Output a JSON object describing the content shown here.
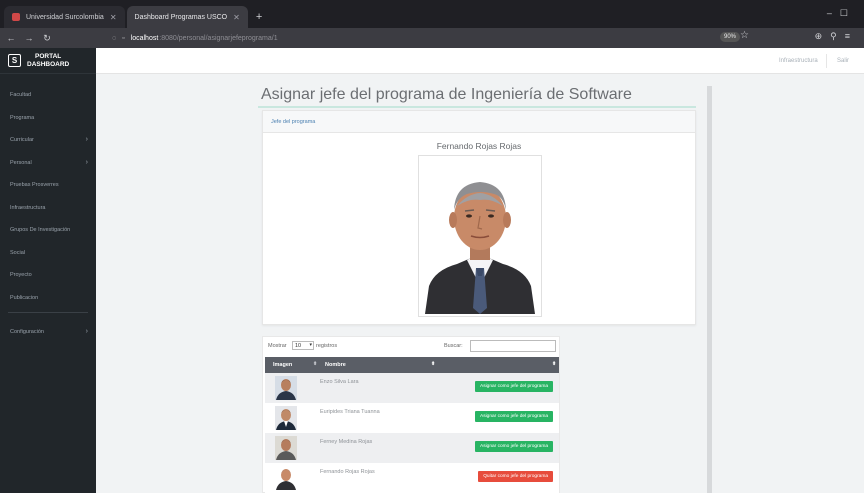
{
  "browser": {
    "tabs": [
      {
        "label": "Universidad Surcolombia",
        "active": false
      },
      {
        "label": "Dashboard Programas USCO",
        "active": true
      }
    ],
    "new_tab": "+",
    "url_host": "localhost",
    "url_path": ":8080/personal/asignarjefeprograma/1",
    "zoom": "90%"
  },
  "header": {
    "user_link": "Infraestructura",
    "exit_link": "Salir"
  },
  "sidebar": {
    "brand_line1": "PORTAL",
    "brand_line2": "DASHBOARD",
    "brand_logo": "S",
    "items": [
      {
        "label": "Facultad",
        "has_submenu": false
      },
      {
        "label": "Programa",
        "has_submenu": false
      },
      {
        "label": "Curricular",
        "has_submenu": true
      },
      {
        "label": "Personal",
        "has_submenu": true
      },
      {
        "label": "Pruebas Prosverres",
        "has_submenu": false
      },
      {
        "label": "Infraestructura",
        "has_submenu": false
      },
      {
        "label": "Grupos De Investigación",
        "has_submenu": false
      },
      {
        "label": "Social",
        "has_submenu": false
      },
      {
        "label": "Proyecto",
        "has_submenu": false
      },
      {
        "label": "Publicacion",
        "has_submenu": false
      }
    ],
    "config_item": {
      "label": "Configuración",
      "has_submenu": true
    }
  },
  "main": {
    "title": "Asignar jefe del programa de Ingeniería de Software",
    "card_header": "Jefe del programa",
    "current_head_name": "Fernando Rojas Rojas"
  },
  "table": {
    "show_label": "Mostrar",
    "show_value": "10",
    "records_label": "registros",
    "search_label": "Buscar:",
    "search_value": "",
    "columns": [
      "Imagen",
      "Nombre",
      ""
    ],
    "rows": [
      {
        "name": "Enzo Silva Lara",
        "action": "Asignar como jefe del programa",
        "action_type": "assign"
      },
      {
        "name": "Euripides Triana Tuanna",
        "action": "Asignar como jefe del programa",
        "action_type": "assign"
      },
      {
        "name": "Ferney Medina Rojas",
        "action": "Asignar como jefe del programa",
        "action_type": "assign"
      },
      {
        "name": "Fernando Rojas Rojas",
        "action": "Quitar como jefe del programa",
        "action_type": "remove"
      }
    ]
  },
  "colors": {
    "sidebar_bg": "#21262a",
    "header_table_bg": "#5a5e66",
    "assign_button": "#28b463",
    "remove_button": "#e74c3c",
    "card_header_text": "#4a7fb0"
  }
}
